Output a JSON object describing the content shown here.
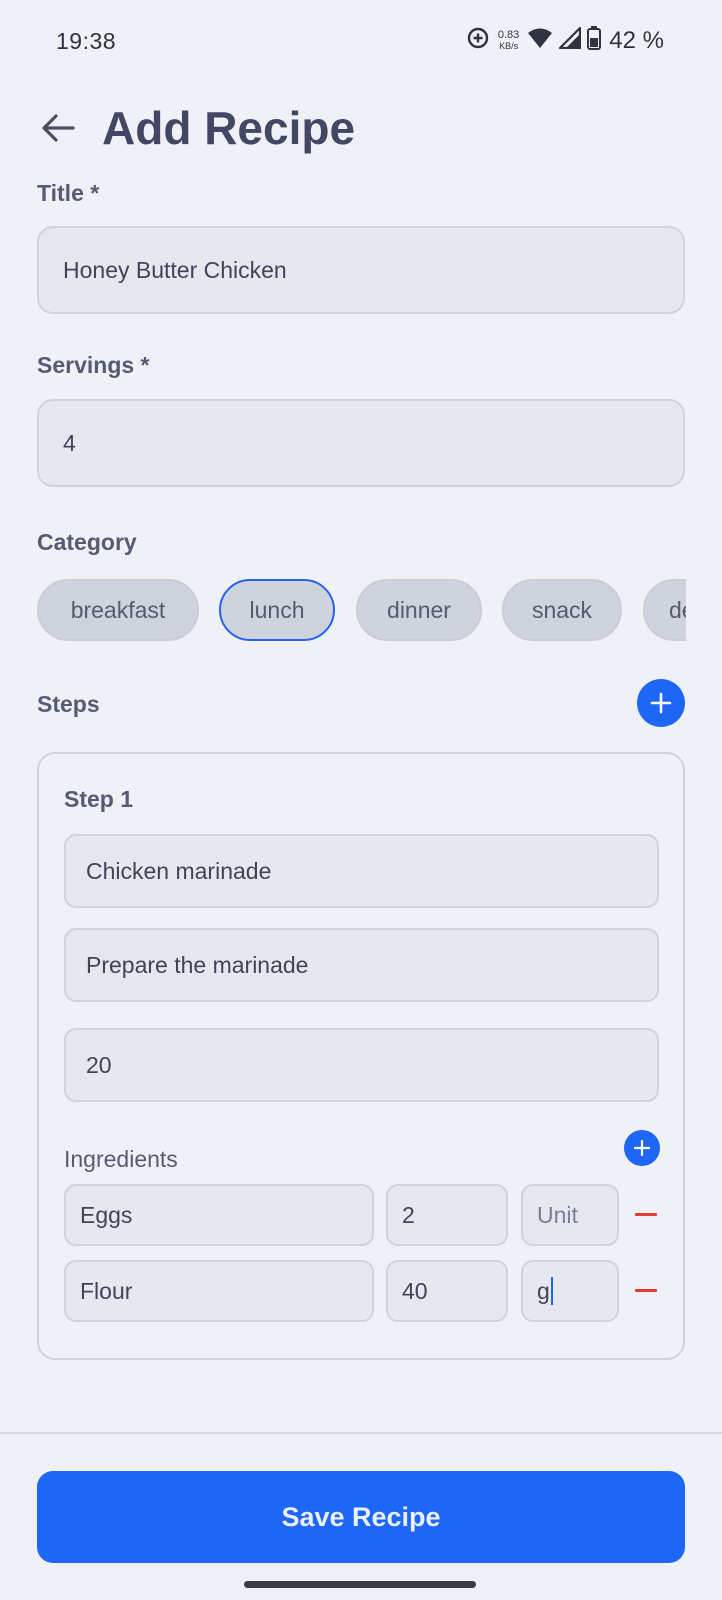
{
  "status_bar": {
    "time": "19:38",
    "net_speed_value": "0.83",
    "net_speed_unit": "KB/s",
    "battery": "42 %"
  },
  "header": {
    "title": "Add Recipe"
  },
  "form": {
    "title_label": "Title *",
    "title_value": "Honey Butter Chicken",
    "servings_label": "Servings *",
    "servings_value": "4",
    "category_label": "Category",
    "categories": [
      "breakfast",
      "lunch",
      "dinner",
      "snack",
      "de"
    ],
    "selected_category": "lunch",
    "steps_label": "Steps"
  },
  "steps": [
    {
      "title": "Step 1",
      "name": "Chicken marinade",
      "description": "Prepare the marinade",
      "duration": "20",
      "ingredients_label": "Ingredients",
      "ingredients": [
        {
          "name": "Eggs",
          "quantity": "2",
          "unit": "Unit"
        },
        {
          "name": "Flour",
          "quantity": "40",
          "unit": "g"
        }
      ]
    }
  ],
  "actions": {
    "save_label": "Save Recipe"
  },
  "colors": {
    "accent": "#1e66f5",
    "remove": "#e53935",
    "background": "#eff1f6"
  }
}
